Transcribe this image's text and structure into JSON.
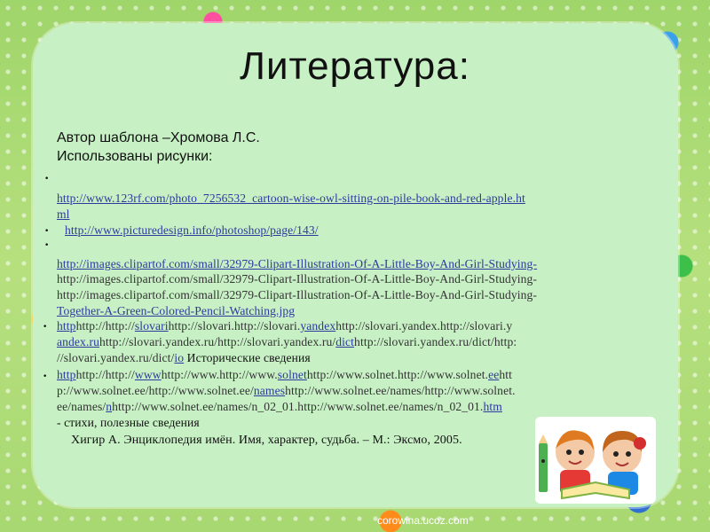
{
  "slide": {
    "title": "Литература:",
    "author_line": "Автор шаблона –Хромова Л.С.",
    "images_used": "Использованы рисунки:",
    "link1_a": "http://www.123rf.com/photo_7256532_cartoon-wise-owl-sitting-on-pile-book-and-red-apple.ht",
    "link1_b": "ml",
    "link2": "http://www.picturedesign.info/photoshop/page/143/",
    "link3_a": "http://images.clipartof.com/small/32979-Clipart-Illustration-Of-A-Little-Boy-And-Girl-Studying-",
    "link3_b": "http://images.clipartof.com/small/32979-Clipart-Illustration-Of-A-Little-Boy-And-Girl-Studying-",
    "link3_c": "http://images.clipartof.com/small/32979-Clipart-Illustration-Of-A-Little-Boy-And-Girl-Studying-",
    "link3_d": "Together-A-Green-Colored-Pencil-Watching.jpg",
    "l4a_1": "http",
    "l4a_2": "http://http://",
    "l4a_3": "slovari",
    "l4a_4": "http://slovari.http://slovari.",
    "l4a_5": "yandex",
    "l4a_6": "http://slovari.yandex.http://slovari.y",
    "l4b_1": "andex.ru",
    "l4b_2": "http://slovari.yandex.ru/http://slovari.yandex.ru/",
    "l4b_3": "dict",
    "l4b_4": "http://slovari.yandex.ru/dict/http:",
    "l4c_1": "//slovari.yandex.ru/dict/",
    "l4c_2": "io",
    "l4c_3": " Исторические сведения",
    "l5a_1": "http",
    "l5a_2": "http://http://",
    "l5a_3": "www",
    "l5a_4": "http://www.http://www.",
    "l5a_5": "solnet",
    "l5a_6": "http://www.solnet.http://www.solnet.",
    "l5a_7": "ee",
    "l5a_8": "htt",
    "l5b_1": "p://www.solnet.ee/http://www.solnet.ee/",
    "l5b_2": "names",
    "l5b_3": "http://www.solnet.ee/names/http://www.solnet.",
    "l5c_1": "ee/names/",
    "l5c_2": "n",
    "l5c_3": "http://www.solnet.ee/names/n_02_01.http://www.solnet.ee/names/n_02_01.",
    "l5c_4": "htm",
    "l5d": " - стихи, полезные сведения",
    "book_ref": "Хигир А. Энциклопедия имён. Имя, характер, судьба. – М.: Эксмо, 2005.",
    "footer": "corowina.ucoz.com",
    "bullet_glyph": "•"
  }
}
